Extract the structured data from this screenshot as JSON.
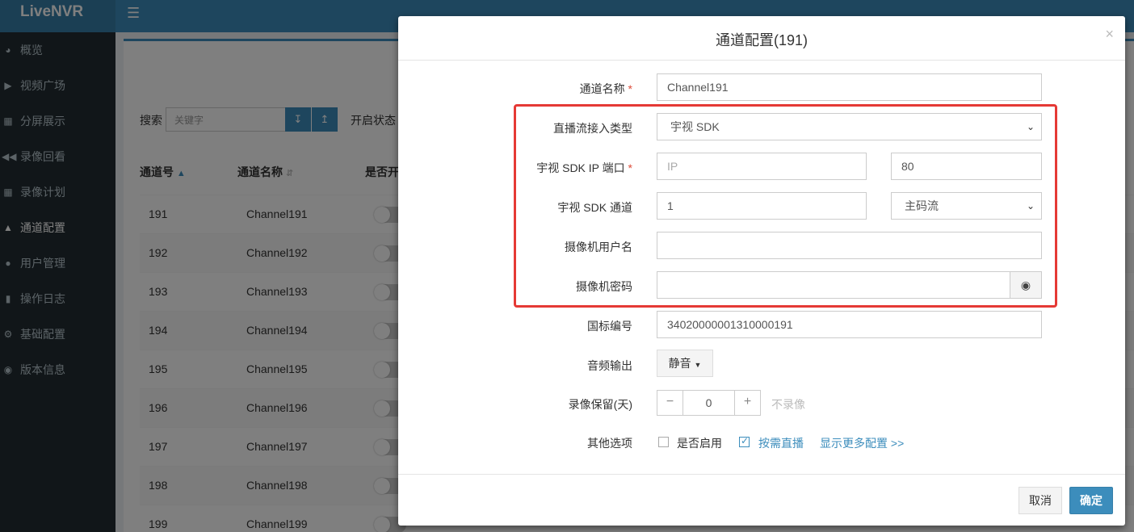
{
  "app": {
    "title": "LiveNVR"
  },
  "sidebar": {
    "items": [
      {
        "label": "概览",
        "icon": "dashboard-icon"
      },
      {
        "label": "视频广场",
        "icon": "video-camera-icon"
      },
      {
        "label": "分屏展示",
        "icon": "grid-icon"
      },
      {
        "label": "录像回看",
        "icon": "rewind-icon"
      },
      {
        "label": "录像计划",
        "icon": "calendar-icon"
      },
      {
        "label": "通道配置",
        "icon": "sitemap-icon",
        "active": true
      },
      {
        "label": "用户管理",
        "icon": "users-icon"
      },
      {
        "label": "操作日志",
        "icon": "file-icon"
      },
      {
        "label": "基础配置",
        "icon": "cogs-icon"
      },
      {
        "label": "版本信息",
        "icon": "globe-icon"
      }
    ]
  },
  "toolbar": {
    "search_label": "搜索",
    "search_placeholder": "关键字",
    "state_label": "开启状态"
  },
  "table": {
    "headers": [
      "通道号",
      "通道名称",
      "是否开"
    ],
    "rows": [
      {
        "id": "191",
        "name": "Channel191"
      },
      {
        "id": "192",
        "name": "Channel192"
      },
      {
        "id": "193",
        "name": "Channel193"
      },
      {
        "id": "194",
        "name": "Channel194"
      },
      {
        "id": "195",
        "name": "Channel195"
      },
      {
        "id": "196",
        "name": "Channel196"
      },
      {
        "id": "197",
        "name": "Channel197"
      },
      {
        "id": "198",
        "name": "Channel198"
      },
      {
        "id": "199",
        "name": "Channel199"
      }
    ]
  },
  "modal": {
    "title": "通道配置(191)",
    "close": "×",
    "fields": {
      "channel_name_label": "通道名称",
      "channel_name_value": "Channel191",
      "stream_type_label": "直播流接入类型",
      "stream_type_value": "宇视 SDK",
      "sdk_ip_label": "宇视 SDK IP 端口",
      "sdk_ip_placeholder": "IP",
      "sdk_port_value": "80",
      "sdk_channel_label": "宇视 SDK 通道",
      "sdk_channel_value": "1",
      "stream_select_value": "主码流",
      "camera_user_label": "摄像机用户名",
      "camera_user_value": "",
      "camera_pwd_label": "摄像机密码",
      "camera_pwd_value": "",
      "gb_code_label": "国标编号",
      "gb_code_value": "34020000001310000191",
      "audio_label": "音频输出",
      "audio_value": "静音",
      "record_label": "录像保留(天)",
      "record_value": "0",
      "record_minus": "−",
      "record_plus": "+",
      "record_hint": "不录像",
      "other_label": "其他选项",
      "enable_label": "是否启用",
      "ondemand_label": "按需直播",
      "more_link": "显示更多配置 >>"
    },
    "required_mark": "*",
    "cancel_label": "取消",
    "ok_label": "确定"
  },
  "colors": {
    "primary": "#3c8dbc",
    "sidebar_bg": "#222d32",
    "highlight": "#e53935"
  }
}
